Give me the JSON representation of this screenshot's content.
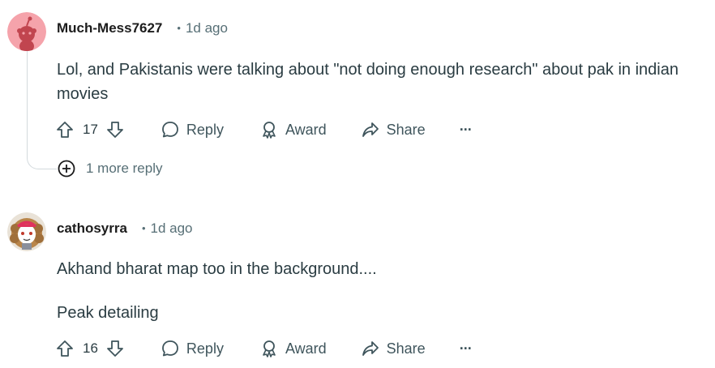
{
  "comments": [
    {
      "author": "Much-Mess7627",
      "time": "1d ago",
      "body": [
        "Lol, and Pakistanis were talking about \"not doing enough research\" about pak in indian movies"
      ],
      "score": "17",
      "actions": {
        "reply": "Reply",
        "award": "Award",
        "share": "Share",
        "more": "···"
      },
      "more_replies": "1 more reply"
    },
    {
      "author": "cathosyrra",
      "time": "1d ago",
      "body": [
        "Akhand bharat map too in the background....",
        "Peak detailing"
      ],
      "score": "16",
      "actions": {
        "reply": "Reply",
        "award": "Award",
        "share": "Share",
        "more": "···"
      }
    }
  ],
  "separator": "•",
  "colors": {
    "avatar1_bg": "#f5a3ab",
    "avatar1_fg": "#c1454f",
    "meta_text": "#576f76",
    "thread_line": "#d3dadd"
  }
}
